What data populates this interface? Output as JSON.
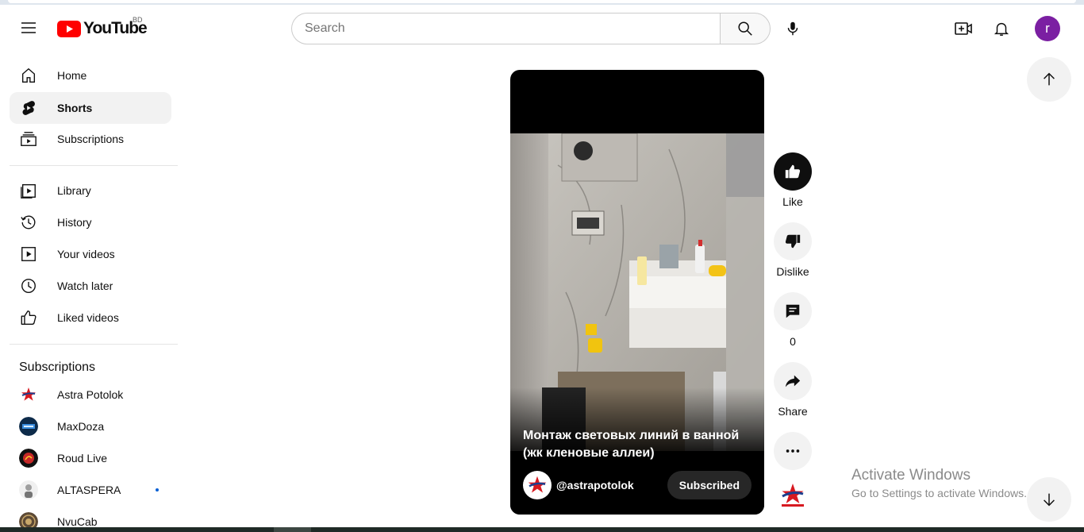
{
  "header": {
    "logo_text": "YouTube",
    "region": "BD",
    "search_placeholder": "Search",
    "avatar_letter": "r"
  },
  "sidebar": {
    "primary": [
      {
        "label": "Home",
        "icon": "home-icon",
        "active": false
      },
      {
        "label": "Shorts",
        "icon": "shorts-icon",
        "active": true
      },
      {
        "label": "Subscriptions",
        "icon": "subscriptions-icon",
        "active": false
      }
    ],
    "library": [
      {
        "label": "Library",
        "icon": "library-icon"
      },
      {
        "label": "History",
        "icon": "history-icon"
      },
      {
        "label": "Your videos",
        "icon": "your-videos-icon"
      },
      {
        "label": "Watch later",
        "icon": "watch-later-icon"
      },
      {
        "label": "Liked videos",
        "icon": "liked-videos-icon"
      }
    ],
    "subscriptions_title": "Subscriptions",
    "subscriptions": [
      {
        "name": "Astra Potolok",
        "new": false
      },
      {
        "name": "MaxDoza",
        "new": false
      },
      {
        "name": "Roud Live",
        "new": false
      },
      {
        "name": "ALTASPERA",
        "new": true
      },
      {
        "name": "NvuCab",
        "new": false
      }
    ]
  },
  "short": {
    "title": "Монтаж световых линий в ванной (жк кленовые аллеи)",
    "channel_handle": "@astrapotolok",
    "subscribe_label": "Subscribed"
  },
  "actions": {
    "like_label": "Like",
    "dislike_label": "Dislike",
    "comments_count": "0",
    "share_label": "Share"
  },
  "watermark": {
    "line1": "Activate Windows",
    "line2": "Go to Settings to activate Windows."
  },
  "colors": {
    "brand_red": "#ff0000",
    "avatar_purple": "#7b1fa2",
    "active_bg": "#f2f2f2"
  }
}
